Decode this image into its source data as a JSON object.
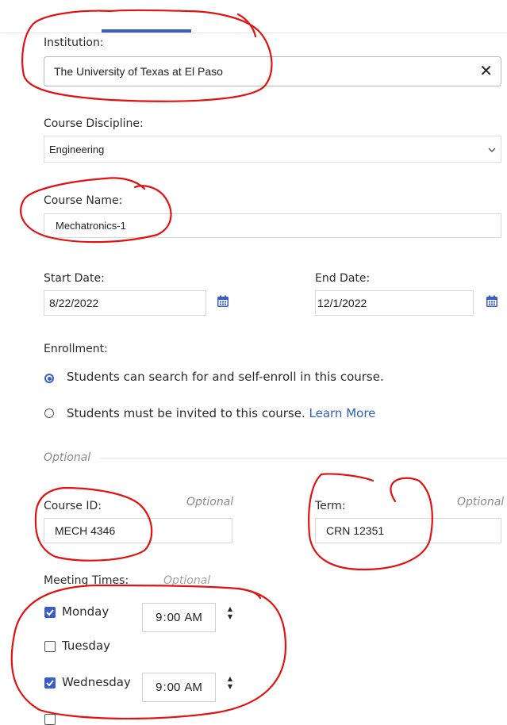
{
  "institution": {
    "label": "Institution:",
    "value": "The University of Texas at El Paso",
    "clear_icon": "close-icon"
  },
  "discipline": {
    "label": "Course Discipline:",
    "value": "Engineering",
    "dropdown_icon": "chevron-down-icon"
  },
  "course_name": {
    "label": "Course Name:",
    "value": "Mechatronics-1"
  },
  "start_date": {
    "label": "Start Date:",
    "value": "8/22/2022",
    "icon": "calendar-icon"
  },
  "end_date": {
    "label": "End Date:",
    "value": "12/1/2022",
    "icon": "calendar-icon"
  },
  "enrollment": {
    "label": "Enrollment:",
    "options": [
      {
        "text": "Students can search for and self-enroll in this course.",
        "selected": true
      },
      {
        "text": "Students must be invited to this course.",
        "selected": false,
        "link": "Learn More"
      }
    ]
  },
  "optional_divider": "Optional",
  "course_id": {
    "label": "Course ID:",
    "optional": "Optional",
    "value": "MECH 4346"
  },
  "term": {
    "label": "Term:",
    "optional": "Optional",
    "value": "CRN 12351"
  },
  "meeting_times": {
    "label": "Meeting Times:",
    "optional": "Optional",
    "days": [
      {
        "day": "Monday",
        "checked": true,
        "hour": "9",
        "sep": ":",
        "minute": "00",
        "ampm": "AM"
      },
      {
        "day": "Tuesday",
        "checked": false
      },
      {
        "day": "Wednesday",
        "checked": true,
        "hour": "9",
        "sep": ":",
        "minute": "00",
        "ampm": "AM"
      }
    ]
  },
  "colors": {
    "accent": "#3b5ec6",
    "link": "#2f5fb3",
    "annotation": "#e01212",
    "border": "#d7d7d7"
  }
}
